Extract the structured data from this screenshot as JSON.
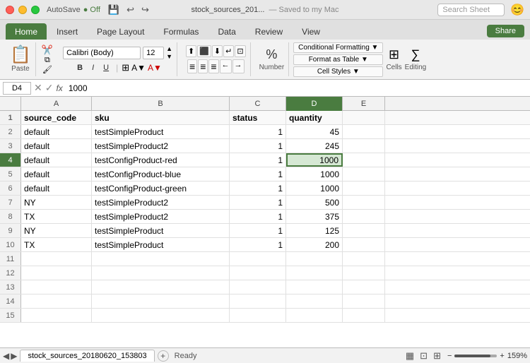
{
  "titlebar": {
    "autosave_label": "AutoSave",
    "autosave_state": "●",
    "filename": "stock_sources_201...",
    "saved_label": "— Saved to my Mac",
    "search_placeholder": "Search Sheet"
  },
  "ribbon": {
    "tabs": [
      "Home",
      "Insert",
      "Page Layout",
      "Formulas",
      "Data",
      "Review",
      "View"
    ],
    "active_tab": "Home",
    "share_label": "Share",
    "font_name": "Calibri (Body)",
    "font_size": "12",
    "bold": "B",
    "italic": "I",
    "underline": "U",
    "percent_symbol": "%",
    "number_label": "Number",
    "cond_format_label": "Conditional Formatting ▼",
    "format_table_label": "Format as Table ▼",
    "cell_styles_label": "Cell Styles ▼",
    "cells_label": "Cells",
    "editing_label": "Editing",
    "paste_label": "Paste"
  },
  "formula_bar": {
    "cell_ref": "D4",
    "formula_value": "1000"
  },
  "columns": [
    {
      "id": "a",
      "label": "A",
      "width": "col-a"
    },
    {
      "id": "b",
      "label": "B",
      "width": "col-b"
    },
    {
      "id": "c",
      "label": "C",
      "width": "col-c"
    },
    {
      "id": "d",
      "label": "D",
      "width": "col-d"
    },
    {
      "id": "e",
      "label": "E",
      "width": "col-e"
    }
  ],
  "rows": [
    {
      "num": "1",
      "a": "source_code",
      "b": "sku",
      "c": "status",
      "d": "quantity",
      "e": "",
      "selected_col": "d",
      "header": true
    },
    {
      "num": "2",
      "a": "default",
      "b": "testSimpleProduct",
      "c": "1",
      "d": "45",
      "e": ""
    },
    {
      "num": "3",
      "a": "default",
      "b": "testSimpleProduct2",
      "c": "1",
      "d": "245",
      "e": ""
    },
    {
      "num": "4",
      "a": "default",
      "b": "testConfigProduct-red",
      "c": "1",
      "d": "1000",
      "e": "",
      "selected": true
    },
    {
      "num": "5",
      "a": "default",
      "b": "testConfigProduct-blue",
      "c": "1",
      "d": "1000",
      "e": ""
    },
    {
      "num": "6",
      "a": "default",
      "b": "testConfigProduct-green",
      "c": "1",
      "d": "1000",
      "e": ""
    },
    {
      "num": "7",
      "a": "NY",
      "b": "testSimpleProduct2",
      "c": "1",
      "d": "500",
      "e": ""
    },
    {
      "num": "8",
      "a": "TX",
      "b": "testSimpleProduct2",
      "c": "1",
      "d": "375",
      "e": ""
    },
    {
      "num": "9",
      "a": "NY",
      "b": "testSimpleProduct",
      "c": "1",
      "d": "125",
      "e": ""
    },
    {
      "num": "10",
      "a": "TX",
      "b": "testSimpleProduct",
      "c": "1",
      "d": "200",
      "e": ""
    },
    {
      "num": "11",
      "a": "",
      "b": "",
      "c": "",
      "d": "",
      "e": ""
    },
    {
      "num": "12",
      "a": "",
      "b": "",
      "c": "",
      "d": "",
      "e": ""
    },
    {
      "num": "13",
      "a": "",
      "b": "",
      "c": "",
      "d": "",
      "e": ""
    },
    {
      "num": "14",
      "a": "",
      "b": "",
      "c": "",
      "d": "",
      "e": ""
    },
    {
      "num": "15",
      "a": "",
      "b": "",
      "c": "",
      "d": "",
      "e": ""
    }
  ],
  "bottom": {
    "sheet_name": "stock_sources_20180620_153803",
    "add_sheet_icon": "+",
    "status": "Ready",
    "zoom_level": "159%"
  }
}
